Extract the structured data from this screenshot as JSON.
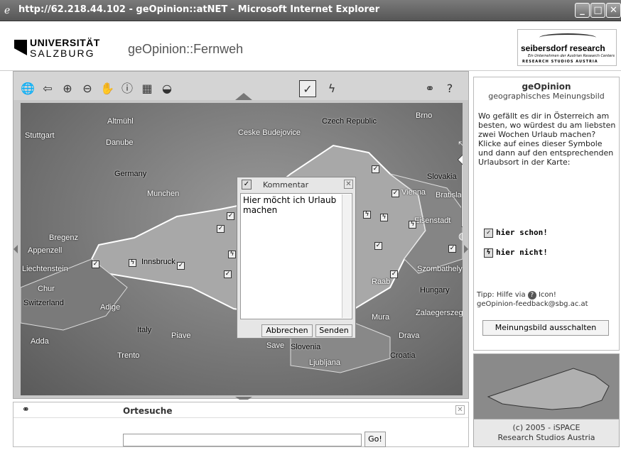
{
  "window": {
    "title": "http://62.218.44.102 - geOpinion::atNET - Microsoft Internet Explorer"
  },
  "header": {
    "uni_line1": "UNIVERSITÄT",
    "uni_line2": "SALZBURG",
    "app_title": "geOpinion::Fernweh",
    "seib_name": "seibersdorf research",
    "seib_sub": "Ein Unternehmen der Austrian Research Centers",
    "seib_rs": "RESEARCH STUDIOS AUSTRIA"
  },
  "map": {
    "labels": [
      "Stuttgart",
      "Danube",
      "Ceske Budejovice",
      "Czech Republic",
      "Brno",
      "Germany",
      "Munchen",
      "Slovakia",
      "Vienna",
      "Bratislava",
      "Eisenstadt",
      "Bregenz",
      "Appenzell",
      "Liechtenstein",
      "Innsbruck",
      "Chur",
      "Switzerland",
      "Szombathely",
      "Hungary",
      "Raab",
      "Zalaegerszeg",
      "Italy",
      "Adda",
      "Trento",
      "Slovenia",
      "Ljubljana",
      "Croatia",
      "Drava",
      "Mura",
      "Save",
      "Piave",
      "Adige",
      "Altmühl"
    ]
  },
  "dialog": {
    "title": "Kommentar",
    "text": "Hier möcht ich Urlaub machen",
    "cancel_label": "Abbrechen",
    "send_label": "Senden"
  },
  "sidebar": {
    "title": "geOpinion",
    "subtitle": "geographisches Meinungsbild",
    "body": "Wo gefällt es dir in Österreich am besten, wo würdest du am liebsten zwei Wochen Urlaub machen? Klicke auf eines dieser Symbole und dann auf den entsprechenden Urlaubsort in der Karte:",
    "legend_yes": "hier schon!",
    "legend_no": "hier nicht!",
    "tip_line1_pre": "Tipp: Hilfe via",
    "tip_line1_post": "Icon!",
    "tip_line2": "geOpinion-feedback@sbg.ac.at",
    "toggle_button": "Meinungsbild ausschalten"
  },
  "credit": {
    "line1": "(c) 2005 - iSPACE",
    "line2": "Research Studios Austria"
  },
  "search": {
    "title": "Ortesuche",
    "value": "",
    "go_label": "Go!"
  }
}
